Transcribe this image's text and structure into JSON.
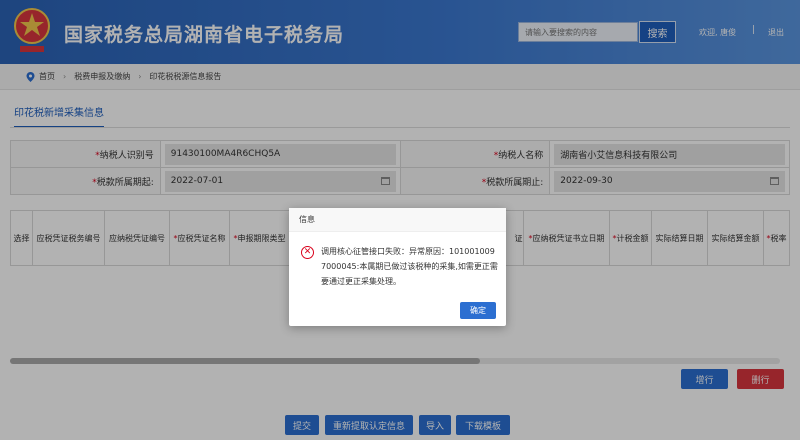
{
  "header": {
    "site_title": "国家税务总局湖南省电子税务局",
    "search_placeholder": "请输入要搜索的内容",
    "search_button": "搜索",
    "welcome": "欢迎, 唐俊",
    "separator": "|",
    "logout": "退出"
  },
  "breadcrumb": {
    "items": [
      "首页",
      "税费申报及缴纳",
      "印花税税源信息报告"
    ],
    "separator": "›"
  },
  "tab": {
    "label": "印花税新增采集信息"
  },
  "form": {
    "taxpayer_id_label": "纳税人识别号",
    "taxpayer_id_value": "91430100MA4R6CHQ5A",
    "taxpayer_name_label": "纳税人名称",
    "taxpayer_name_value": "湖南省小艾信息科技有限公司",
    "period_start_label": "税款所属期起:",
    "period_start_value": "2022-07-01",
    "period_end_label": "税款所属期止:",
    "period_end_value": "2022-09-30",
    "required_mark": "*"
  },
  "grid": {
    "headers": [
      {
        "label": "选择",
        "required": false
      },
      {
        "label": "应税凭证税务编号",
        "required": false
      },
      {
        "label": "应纳税凭证编号",
        "required": false
      },
      {
        "label": "应税凭证名称",
        "required": true
      },
      {
        "label": "申报期限类型",
        "required": true
      },
      {
        "label": "",
        "required": false
      },
      {
        "label": "证",
        "required": false
      },
      {
        "label": "应纳税凭证书立日期",
        "required": true
      },
      {
        "label": "计税金额",
        "required": true
      },
      {
        "label": "实际结算日期",
        "required": false
      },
      {
        "label": "实际结算金额",
        "required": false
      },
      {
        "label": "税率",
        "required": true
      }
    ]
  },
  "actions": {
    "add_row": "增行",
    "delete_row": "删行",
    "submit": "提交",
    "refetch": "重新提取认定信息",
    "import": "导入",
    "download_template": "下载模板"
  },
  "dialog": {
    "title": "信息",
    "message": "调用核心征管接口失败：异常原因：1010010097000045:本属期已做过该税种的采集,如需更正需要通过更正采集处理。",
    "ok": "确定",
    "icon": "error-icon"
  },
  "colors": {
    "header_blue": "#2b63b6",
    "button_blue": "#2c6fd1",
    "button_red": "#d9363e",
    "required_red": "#d9001b"
  }
}
